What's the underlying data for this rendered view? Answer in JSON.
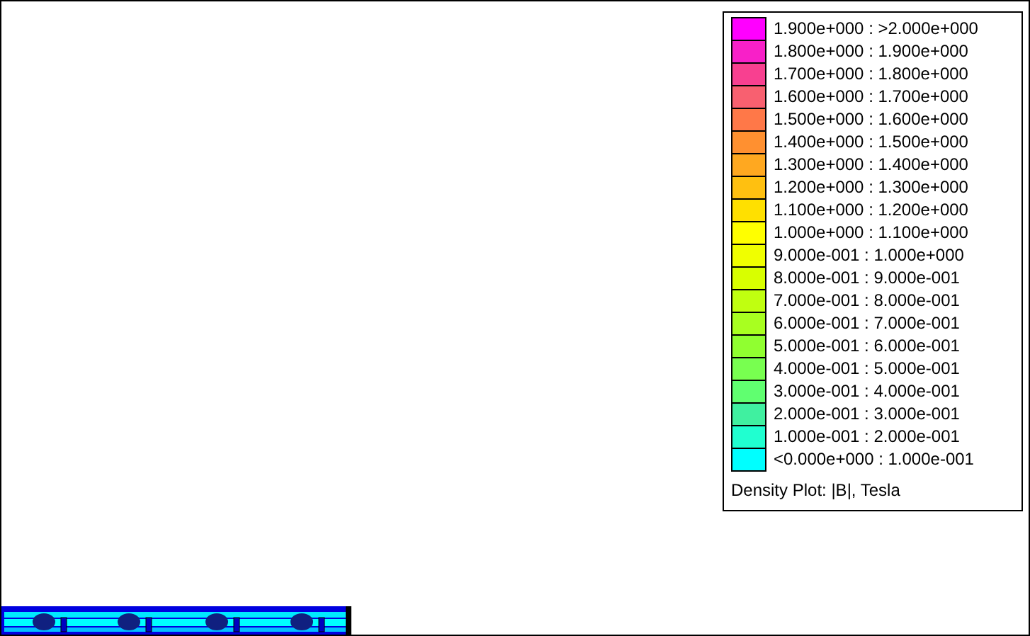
{
  "legend": {
    "entries": [
      {
        "label": "1.900e+000 : >2.000e+000",
        "color": "#ff00ff"
      },
      {
        "label": "1.800e+000 : 1.900e+000",
        "color": "#f820c8"
      },
      {
        "label": "1.700e+000 : 1.800e+000",
        "color": "#f84090"
      },
      {
        "label": "1.600e+000 : 1.700e+000",
        "color": "#f86070"
      },
      {
        "label": "1.500e+000 : 1.600e+000",
        "color": "#ff7848"
      },
      {
        "label": "1.400e+000 : 1.500e+000",
        "color": "#ff9030"
      },
      {
        "label": "1.300e+000 : 1.400e+000",
        "color": "#ffa820"
      },
      {
        "label": "1.200e+000 : 1.300e+000",
        "color": "#ffc010"
      },
      {
        "label": "1.100e+000 : 1.200e+000",
        "color": "#ffe000"
      },
      {
        "label": "1.000e+000 : 1.100e+000",
        "color": "#ffff00"
      },
      {
        "label": "9.000e-001 : 1.000e+000",
        "color": "#f0ff00"
      },
      {
        "label": "8.000e-001 : 9.000e-001",
        "color": "#d8ff00"
      },
      {
        "label": "7.000e-001 : 8.000e-001",
        "color": "#c0ff10"
      },
      {
        "label": "6.000e-001 : 7.000e-001",
        "color": "#a8ff20"
      },
      {
        "label": "5.000e-001 : 6.000e-001",
        "color": "#90ff30"
      },
      {
        "label": "4.000e-001 : 5.000e-001",
        "color": "#78ff50"
      },
      {
        "label": "3.000e-001 : 4.000e-001",
        "color": "#60ff70"
      },
      {
        "label": "2.000e-001 : 3.000e-001",
        "color": "#40f0a0"
      },
      {
        "label": "1.000e-001 : 2.000e-001",
        "color": "#20ffd0"
      },
      {
        "label": "<0.000e+000 : 1.000e-001",
        "color": "#00ffff"
      }
    ],
    "title": "Density Plot: |B|, Tesla"
  }
}
